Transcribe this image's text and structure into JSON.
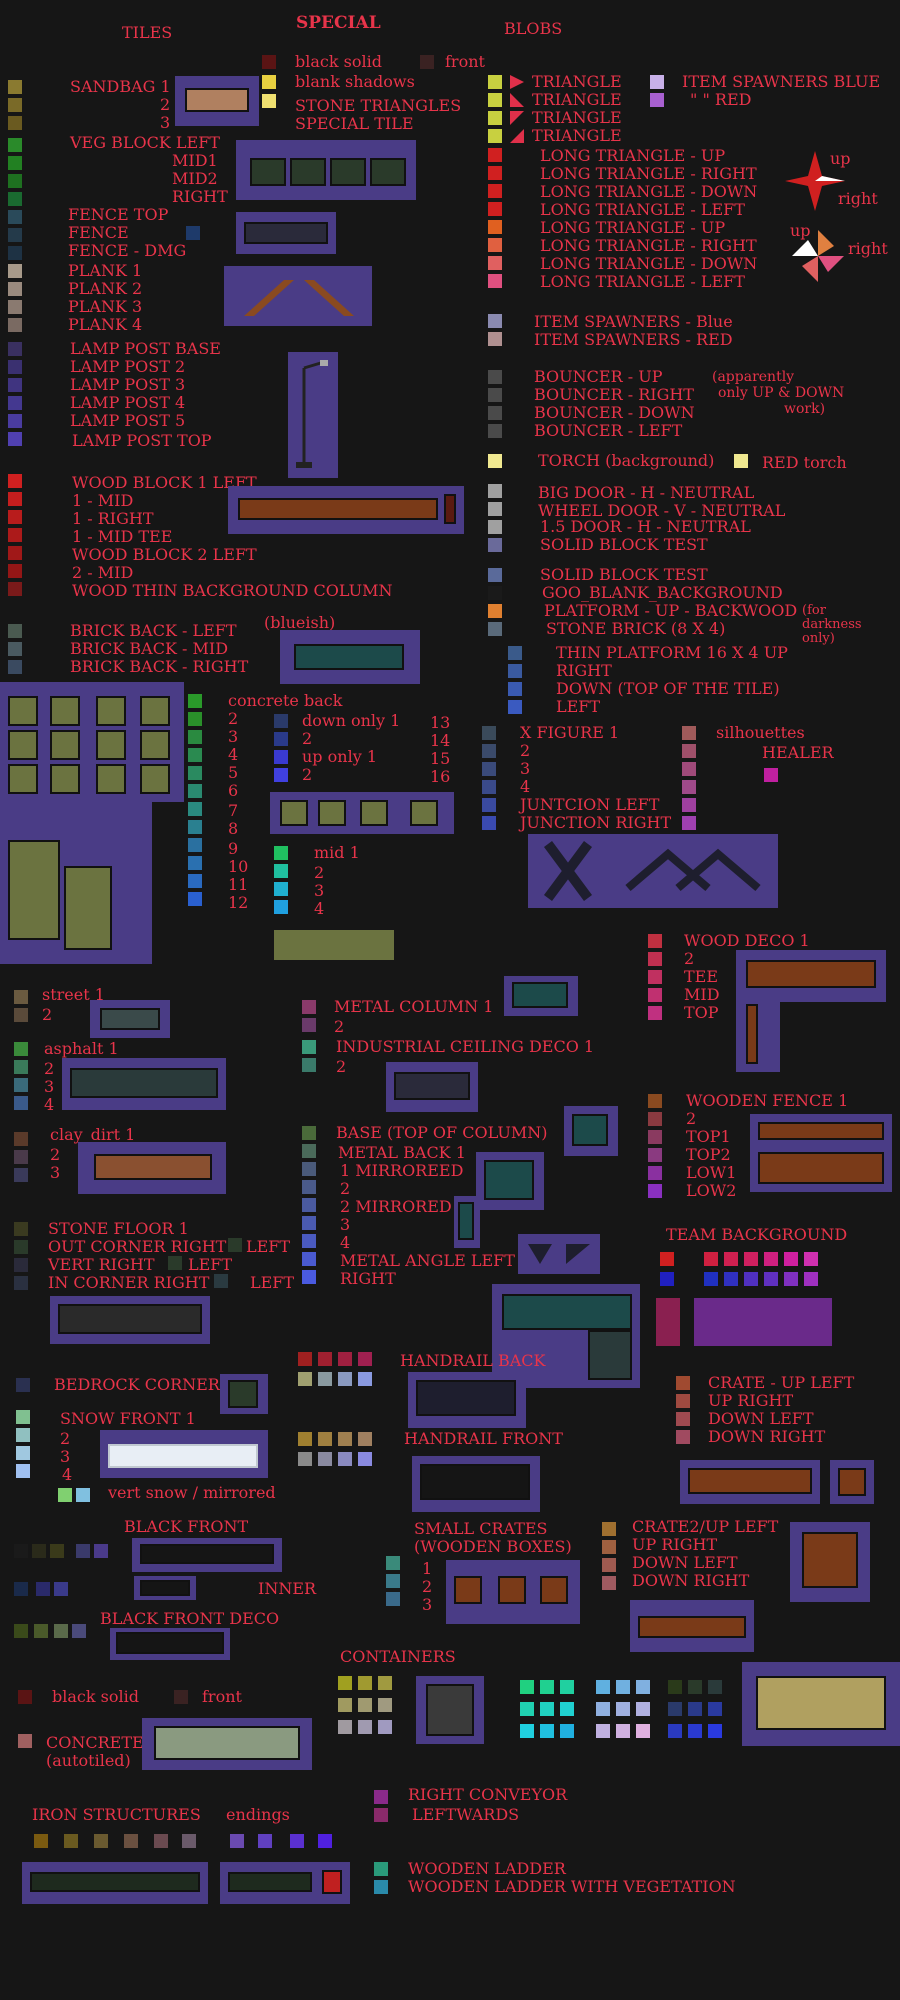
{
  "headers": {
    "tiles": "TILES",
    "special": "SPECIAL",
    "blobs": "BLOBS"
  },
  "special": [
    "black solid",
    "front",
    "blank shadows",
    "STONE TRIANGLES",
    "SPECIAL TILE"
  ],
  "sandbag": [
    "SANDBAG 1",
    "2",
    "3"
  ],
  "veg": [
    "VEG BLOCK LEFT",
    "MID1",
    "MID2",
    "RIGHT"
  ],
  "fence": [
    "FENCE TOP",
    "FENCE",
    "FENCE - DMG"
  ],
  "plank": [
    "PLANK 1",
    "PLANK 2",
    "PLANK 3",
    "PLANK 4"
  ],
  "lamp": [
    "LAMP POST BASE",
    "LAMP POST 2",
    "LAMP POST 3",
    "LAMP POST 4",
    "LAMP POST  5",
    "LAMP POST TOP"
  ],
  "wood": [
    "WOOD BLOCK 1 LEFT",
    "1 - MID",
    "1 - RIGHT",
    "1 - MID TEE",
    "WOOD BLOCK 2 LEFT",
    "2 - MID",
    "WOOD THIN BACKGROUND COLUMN"
  ],
  "brick": [
    "BRICK BACK - LEFT",
    "BRICK BACK - MID",
    "BRICK BACK - RIGHT",
    "(blueish)"
  ],
  "concrete": {
    "title": "concrete back",
    "nums": [
      "2",
      "3",
      "4",
      "5",
      "6",
      "7",
      "8",
      "9",
      "10",
      "11",
      "12"
    ]
  },
  "down_up": [
    "down only 1",
    "2",
    "up only 1",
    "2",
    "13",
    "14",
    "15",
    "16"
  ],
  "mid": [
    "mid 1",
    "2",
    "3",
    "4"
  ],
  "street": [
    "street 1",
    "2"
  ],
  "asphalt": [
    "asphalt 1",
    "2",
    "3",
    "4"
  ],
  "clay": [
    "clay_dirt 1",
    "2",
    "3"
  ],
  "stone_floor": [
    "STONE FLOOR 1",
    "OUT CORNER RIGHT",
    "LEFT",
    "VERT RIGHT",
    "LEFT",
    "IN CORNER RIGHT",
    "LEFT"
  ],
  "bedrock": "BEDROCK CORNER",
  "snow": [
    "SNOW FRONT 1",
    "2",
    "3",
    "4",
    "vert snow / mirrored"
  ],
  "black_front": [
    "BLACK  FRONT",
    "INNER",
    "BLACK  FRONT DECO"
  ],
  "bottom_special": [
    "black solid",
    "front",
    "CONCRETE",
    "(autotiled)"
  ],
  "iron": [
    "IRON STRUCTURES",
    "endings"
  ],
  "blobs": [
    "TRIANGLE",
    "TRIANGLE",
    "TRIANGLE",
    "TRIANGLE",
    "LONG TRIANGLE - UP",
    "LONG TRIANGLE - RIGHT",
    "LONG TRIANGLE - DOWN",
    "LONG TRIANGLE - LEFT",
    "LONG TRIANGLE - UP",
    "LONG TRIANGLE - RIGHT",
    "LONG TRIANGLE - DOWN",
    "LONG TRIANGLE - LEFT"
  ],
  "item_spawners_top": [
    "ITEM SPAWNERS BLUE",
    "\"        \"         RED"
  ],
  "arrows": [
    "up",
    "right",
    "up",
    "right"
  ],
  "item_spawners": [
    "ITEM SPAWNERS - Blue",
    "ITEM SPAWNERS - RED"
  ],
  "bouncer": [
    "BOUNCER - UP",
    "BOUNCER - RIGHT",
    "BOUNCER - DOWN",
    "BOUNCER - LEFT",
    "(apparently",
    "only UP & DOWN",
    "work)"
  ],
  "torch": [
    "TORCH (background)",
    "RED torch"
  ],
  "doors": [
    "BIG DOOR - H - NEUTRAL",
    "WHEEL DOOR - V - NEUTRAL",
    "1.5 DOOR - H - NEUTRAL",
    "SOLID BLOCK TEST"
  ],
  "misc": [
    "SOLID BLOCK TEST",
    "GOO_BLANK_BACKGROUND",
    "PLATFORM - UP - BACKWOOD",
    "STONE BRICK   (8 X 4)",
    "(for",
    "darkness",
    "only)"
  ],
  "thin_platform": [
    "THIN PLATFORM  16 X 4 UP",
    "RIGHT",
    "DOWN (TOP OF THE TILE)",
    "LEFT"
  ],
  "xfigure": [
    "X FIGURE 1",
    "2",
    "3",
    "4",
    "JUNTCION LEFT",
    "JUNCTION RIGHT"
  ],
  "silhouettes": [
    "silhouettes",
    "HEALER"
  ],
  "wood_deco": [
    "WOOD DECO 1",
    "2",
    "TEE",
    "MID",
    "TOP"
  ],
  "metal_col": [
    "METAL COLUMN 1",
    "2"
  ],
  "ind_ceil": [
    "INDUSTRIAL CEILING DECO 1",
    "2"
  ],
  "base_col": [
    "BASE (TOP OF COLUMN)",
    "METAL BACK 1",
    "1 MIRROREED",
    "2",
    "2 MIRRORED",
    "3",
    "4",
    "METAL ANGLE LEFT",
    "RIGHT"
  ],
  "wooden_fence": [
    "WOODEN FENCE 1",
    "2",
    "TOP1",
    "TOP2",
    "LOW1",
    "LOW2"
  ],
  "team_bg": "TEAM BACKGROUND",
  "handrail": [
    "HANDRAIL BACK",
    "HANDRAIL FRONT"
  ],
  "crate": [
    "CRATE - UP LEFT",
    "UP RIGHT",
    "DOWN LEFT",
    "DOWN RIGHT"
  ],
  "small_crates": [
    "SMALL CRATES",
    "(WOODEN BOXES)",
    "1",
    "2",
    "3"
  ],
  "crate2": [
    "CRATE2/UP LEFT",
    "UP RIGHT",
    "DOWN LEFT",
    "DOWN RIGHT"
  ],
  "containers": "CONTAINERS",
  "conveyor": [
    "RIGHT CONVEYOR",
    "LEFTWARDS"
  ],
  "ladder": [
    "WOODEN LADDER",
    "WOODEN LADDER WITH VEGETATION"
  ],
  "colors": {
    "text": "#e8344a",
    "panel": "#4a3c86",
    "bg": "#161616"
  }
}
